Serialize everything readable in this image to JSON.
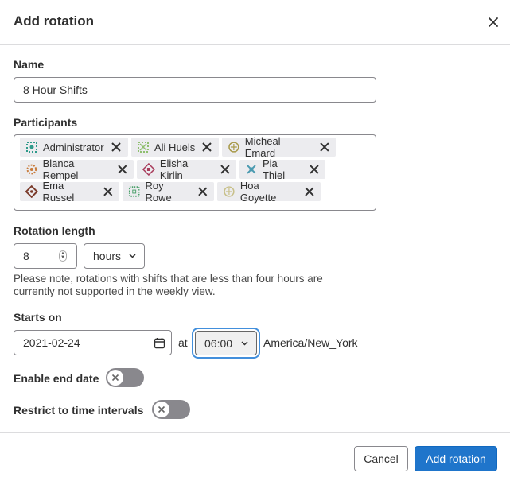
{
  "modal": {
    "title": "Add rotation"
  },
  "name": {
    "label": "Name",
    "value": "8 Hour Shifts"
  },
  "participants": {
    "label": "Participants",
    "items": [
      {
        "name": "Administrator",
        "avatar_color": "#2e9a8a"
      },
      {
        "name": "Ali Huels",
        "avatar_color": "#8fbf6f"
      },
      {
        "name": "Micheal Emard",
        "avatar_color": "#a89a4a"
      },
      {
        "name": "Blanca Rempel",
        "avatar_color": "#c87a3a"
      },
      {
        "name": "Elisha Kirlin",
        "avatar_color": "#a83a5a"
      },
      {
        "name": "Pia Thiel",
        "avatar_color": "#4a9ab0"
      },
      {
        "name": "Ema Russel",
        "avatar_color": "#7a3a2a"
      },
      {
        "name": "Roy Rowe",
        "avatar_color": "#4aa06a"
      },
      {
        "name": "Hoa Goyette",
        "avatar_color": "#c8c08a"
      }
    ]
  },
  "rotation_length": {
    "label": "Rotation length",
    "value": "8",
    "unit": "hours",
    "note": "Please note, rotations with shifts that are less than four hours are currently not supported in the weekly view."
  },
  "starts_on": {
    "label": "Starts on",
    "date": "2021-02-24",
    "at_label": "at",
    "time": "06:00",
    "timezone": "America/New_York"
  },
  "enable_end_date": {
    "label": "Enable end date",
    "on": false
  },
  "restrict_intervals": {
    "label": "Restrict to time intervals",
    "on": false
  },
  "footer": {
    "cancel_label": "Cancel",
    "submit_label": "Add rotation"
  },
  "colors": {
    "primary": "#1f75cb",
    "toggle_off": "#89888d",
    "token_bg": "#ececef"
  }
}
